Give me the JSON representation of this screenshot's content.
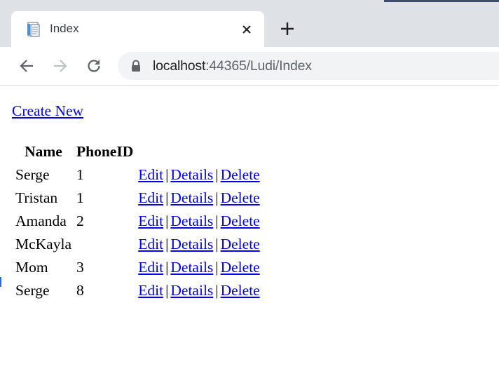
{
  "browser": {
    "tab": {
      "title": "Index",
      "favicon_icon": "page-icon",
      "close_icon": "close-icon"
    },
    "new_tab_icon": "plus-icon",
    "nav": {
      "back_icon": "back-arrow-icon",
      "forward_icon": "forward-arrow-icon",
      "reload_icon": "reload-icon"
    },
    "address_bar": {
      "lock_icon": "lock-icon",
      "host": "localhost",
      "rest": ":44365/Ludi/Index"
    }
  },
  "page": {
    "create_new_label": "Create New",
    "table": {
      "headers": [
        "Name",
        "PhoneID",
        ""
      ],
      "action_labels": {
        "edit": "Edit",
        "details": "Details",
        "delete": "Delete",
        "separator": "|"
      },
      "rows": [
        {
          "name": "Serge",
          "phone_id": "1"
        },
        {
          "name": "Tristan",
          "phone_id": "1"
        },
        {
          "name": "Amanda",
          "phone_id": "2"
        },
        {
          "name": "McKayla",
          "phone_id": ""
        },
        {
          "name": "Mom",
          "phone_id": "3"
        },
        {
          "name": "Serge",
          "phone_id": "8"
        }
      ]
    }
  }
}
